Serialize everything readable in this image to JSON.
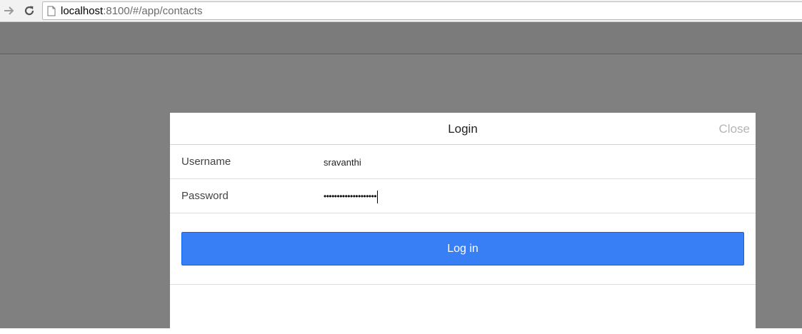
{
  "browser": {
    "url_host": "localhost",
    "url_rest": ":8100/#/app/contacts",
    "forward_icon": "arrow-right-icon",
    "reload_icon": "reload-icon",
    "page_icon": "page-icon"
  },
  "modal": {
    "title": "Login",
    "close_label": "Close",
    "username": {
      "label": "Username",
      "value": "sravanthi"
    },
    "password": {
      "label": "Password",
      "masked_value": "••••••••••••••••••••"
    },
    "login_label": "Log in"
  },
  "colors": {
    "primary": "#387ef5",
    "backdrop": "#808080",
    "close_text": "#b5b5b5"
  }
}
